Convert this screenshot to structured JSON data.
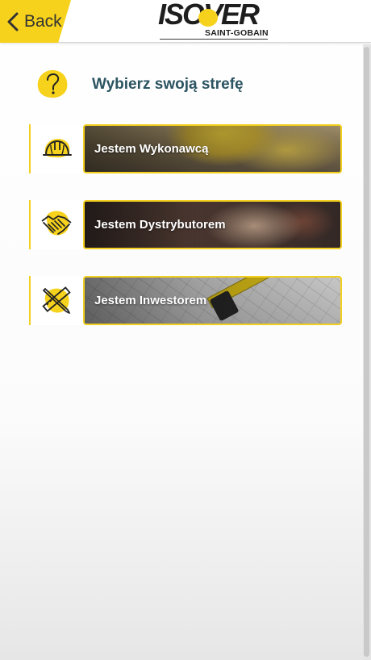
{
  "header": {
    "back_label": "Back",
    "logo_text": "ISOVER",
    "logo_subtitle": "SAINT-GOBAIN"
  },
  "title": "Wybierz swoją strefę",
  "zones": [
    {
      "label": "Jestem Wykonawcą",
      "icon": "hard-hat-icon"
    },
    {
      "label": "Jestem Dystrybutorem",
      "icon": "handshake-icon"
    },
    {
      "label": "Jestem Inwestorem",
      "icon": "ruler-pencil-icon"
    }
  ],
  "colors": {
    "accent": "#f6d21c",
    "title": "#2b5461",
    "text_dark": "#333333"
  }
}
